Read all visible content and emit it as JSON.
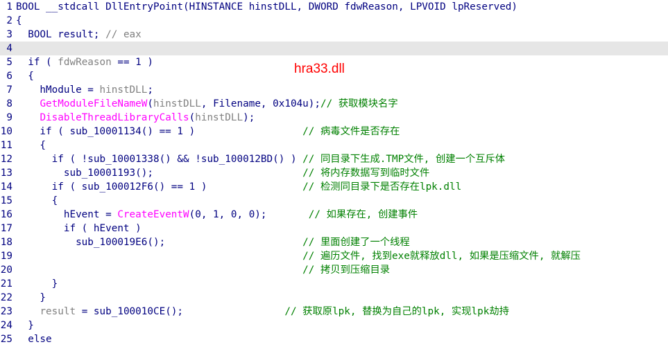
{
  "overlay_label": "hra33.dll",
  "current_line": 4,
  "colors": {
    "keyword": "#000080",
    "variable": "#808080",
    "api": "#ff00ff",
    "comment": "#008000",
    "overlay": "#ff0000",
    "current_line_bg": "#e6e6e6"
  },
  "lines": [
    {
      "num": "1",
      "tokens": [
        {
          "t": "BOOL __stdcall DllEntryPoint(HINSTANCE hinstDLL, DWORD fdwReason, LPVOID lpReserved)",
          "k": "id"
        }
      ]
    },
    {
      "num": "2",
      "tokens": [
        {
          "t": "{",
          "k": "op"
        }
      ]
    },
    {
      "num": "3",
      "tokens": [
        {
          "t": "  BOOL result; ",
          "k": "id"
        },
        {
          "t": "// eax",
          "k": "var"
        }
      ]
    },
    {
      "num": "4",
      "tokens": []
    },
    {
      "num": "5",
      "tokens": [
        {
          "t": "  if ( ",
          "k": "id"
        },
        {
          "t": "fdwReason",
          "k": "var"
        },
        {
          "t": " == 1 )",
          "k": "id"
        }
      ]
    },
    {
      "num": "6",
      "tokens": [
        {
          "t": "  {",
          "k": "op"
        }
      ]
    },
    {
      "num": "7",
      "tokens": [
        {
          "t": "    hModule = ",
          "k": "id"
        },
        {
          "t": "hinstDLL",
          "k": "var"
        },
        {
          "t": ";",
          "k": "op"
        }
      ]
    },
    {
      "num": "8",
      "tokens": [
        {
          "t": "    ",
          "k": "id"
        },
        {
          "t": "GetModuleFileNameW",
          "k": "api"
        },
        {
          "t": "(",
          "k": "op"
        },
        {
          "t": "hinstDLL",
          "k": "var"
        },
        {
          "t": ", Filename, 0x104u);",
          "k": "id"
        },
        {
          "t": "// 获取模块名字",
          "k": "comment"
        }
      ]
    },
    {
      "num": "9",
      "tokens": [
        {
          "t": "    ",
          "k": "id"
        },
        {
          "t": "DisableThreadLibraryCalls",
          "k": "api"
        },
        {
          "t": "(",
          "k": "op"
        },
        {
          "t": "hinstDLL",
          "k": "var"
        },
        {
          "t": ");",
          "k": "op"
        }
      ]
    },
    {
      "num": "10",
      "tokens": [
        {
          "t": "    if ( sub_10001134() == 1 )                  ",
          "k": "id"
        },
        {
          "t": "// 病毒文件是否存在",
          "k": "comment"
        }
      ]
    },
    {
      "num": "11",
      "tokens": [
        {
          "t": "    {",
          "k": "op"
        }
      ]
    },
    {
      "num": "12",
      "tokens": [
        {
          "t": "      if ( !sub_10001338() && !sub_100012BD() ) ",
          "k": "id"
        },
        {
          "t": "// 同目录下生成.TMP文件, 创建一个互斥体",
          "k": "comment"
        }
      ]
    },
    {
      "num": "13",
      "tokens": [
        {
          "t": "        sub_10001193();                         ",
          "k": "id"
        },
        {
          "t": "// 将内存数据写到临时文件",
          "k": "comment"
        }
      ]
    },
    {
      "num": "14",
      "tokens": [
        {
          "t": "      if ( sub_100012F6() == 1 )                ",
          "k": "id"
        },
        {
          "t": "// 检测同目录下是否存在lpk.dll",
          "k": "comment"
        }
      ]
    },
    {
      "num": "15",
      "tokens": [
        {
          "t": "      {",
          "k": "op"
        }
      ]
    },
    {
      "num": "16",
      "tokens": [
        {
          "t": "        hEvent = ",
          "k": "id"
        },
        {
          "t": "CreateEventW",
          "k": "api"
        },
        {
          "t": "(0, 1, 0, 0);       ",
          "k": "id"
        },
        {
          "t": "// 如果存在, 创建事件",
          "k": "comment"
        }
      ]
    },
    {
      "num": "17",
      "tokens": [
        {
          "t": "        if ( hEvent )",
          "k": "id"
        }
      ]
    },
    {
      "num": "18",
      "tokens": [
        {
          "t": "          sub_100019E6();                       ",
          "k": "id"
        },
        {
          "t": "// 里面创建了一个线程",
          "k": "comment"
        }
      ]
    },
    {
      "num": "19",
      "tokens": [
        {
          "t": "                                                ",
          "k": "id"
        },
        {
          "t": "// 遍历文件, 找到exe就释放dll, 如果是压缩文件, 就解压",
          "k": "comment"
        }
      ]
    },
    {
      "num": "20",
      "tokens": [
        {
          "t": "                                                ",
          "k": "id"
        },
        {
          "t": "// 拷贝到压缩目录",
          "k": "comment"
        }
      ]
    },
    {
      "num": "21",
      "tokens": [
        {
          "t": "      }",
          "k": "op"
        }
      ]
    },
    {
      "num": "22",
      "tokens": [
        {
          "t": "    }",
          "k": "op"
        }
      ]
    },
    {
      "num": "23",
      "tokens": [
        {
          "t": "    ",
          "k": "id"
        },
        {
          "t": "result",
          "k": "var"
        },
        {
          "t": " = sub_100010CE();                 ",
          "k": "id"
        },
        {
          "t": "// 获取原lpk, 替换为自己的lpk, 实现lpk劫持",
          "k": "comment"
        }
      ]
    },
    {
      "num": "24",
      "tokens": [
        {
          "t": "  }",
          "k": "op"
        }
      ]
    },
    {
      "num": "25",
      "tokens": [
        {
          "t": "  else",
          "k": "id"
        }
      ]
    }
  ]
}
